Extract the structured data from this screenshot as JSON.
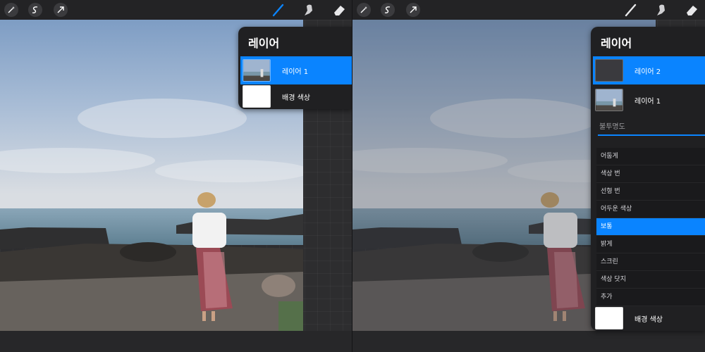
{
  "left": {
    "panel_title": "레이어",
    "layers": [
      {
        "name": "레이어 1",
        "active": true
      },
      {
        "name": "배경 색상",
        "active": false
      }
    ]
  },
  "right": {
    "panel_title": "레이어",
    "layers": [
      {
        "name": "레이어 2",
        "active": true
      },
      {
        "name": "레이어 1",
        "active": false
      }
    ],
    "opacity_label": "불투명도",
    "opacity_value": 1.0,
    "blend_modes": [
      "어둡게",
      "색상 번",
      "선형 번",
      "어두운 색상",
      "보통",
      "밝게",
      "스크린",
      "색상 닷지",
      "추가"
    ],
    "active_blend": "보통",
    "background_layer": "배경 색상"
  },
  "toolbar": {
    "left_icons": [
      "magic-wand-icon",
      "selection-icon",
      "transform-arrow-icon"
    ],
    "right_icons": [
      "brush-icon",
      "smudge-icon",
      "eraser-icon"
    ],
    "accent": "#0a84ff"
  }
}
